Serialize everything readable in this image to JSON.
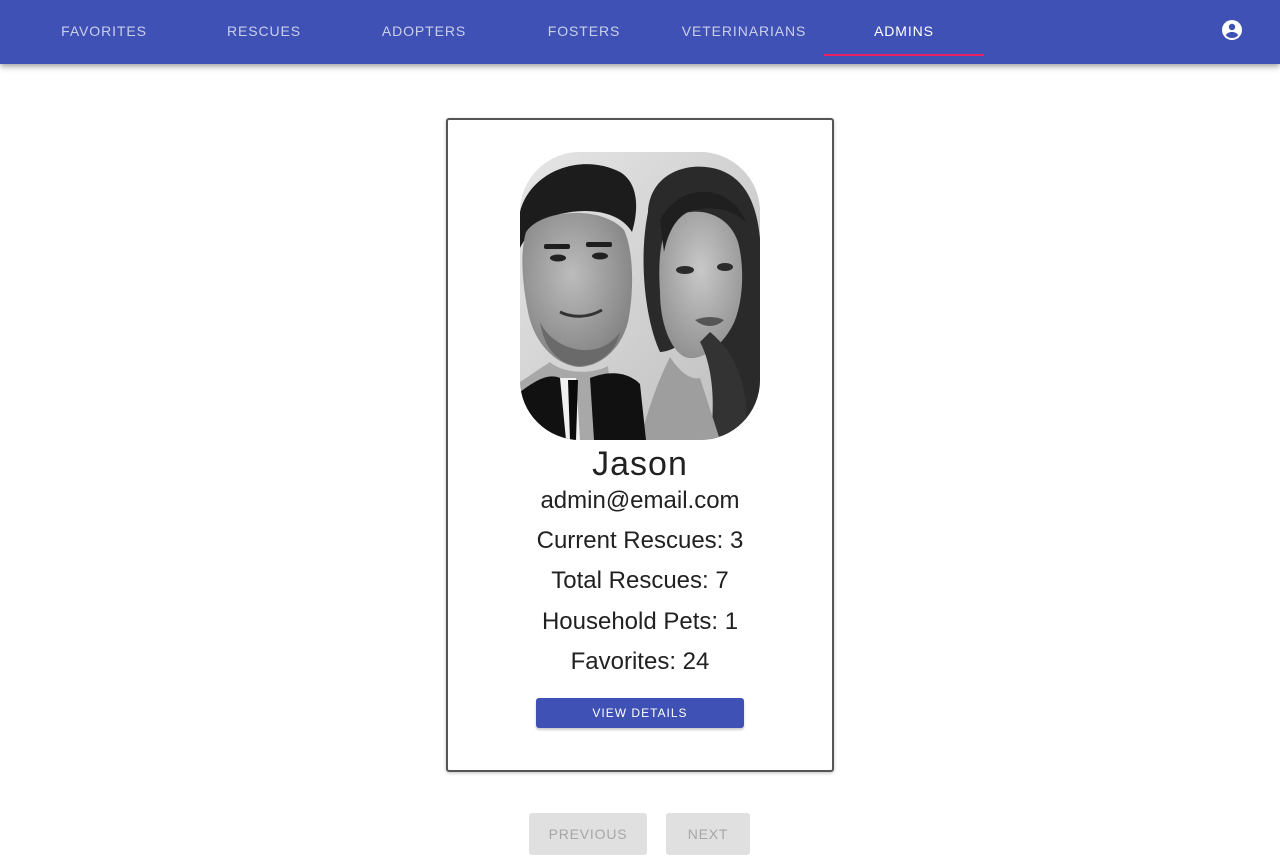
{
  "nav": {
    "tabs": [
      {
        "label": "Favorites"
      },
      {
        "label": "Rescues"
      },
      {
        "label": "Adopters"
      },
      {
        "label": "Fosters"
      },
      {
        "label": "Veterinarians"
      },
      {
        "label": "Admins"
      }
    ],
    "active_tab": "Admins",
    "account_icon": "account-circle-icon"
  },
  "colors": {
    "appbar": "#3f51b5",
    "indicator": "#e91e63",
    "button": "#3f51b5",
    "disabled_button": "#e0e0e0"
  },
  "profile": {
    "photo_icon": "profile-photo",
    "name": "Jason",
    "email": "admin@email.com",
    "current_rescues": "Current Rescues: 3",
    "total_rescues": "Total Rescues: 7",
    "household_pets": "Household Pets: 1",
    "favorites": "Favorites: 24",
    "details_label": "View Details"
  },
  "pagination": {
    "previous_label": "Previous",
    "next_label": "Next"
  }
}
